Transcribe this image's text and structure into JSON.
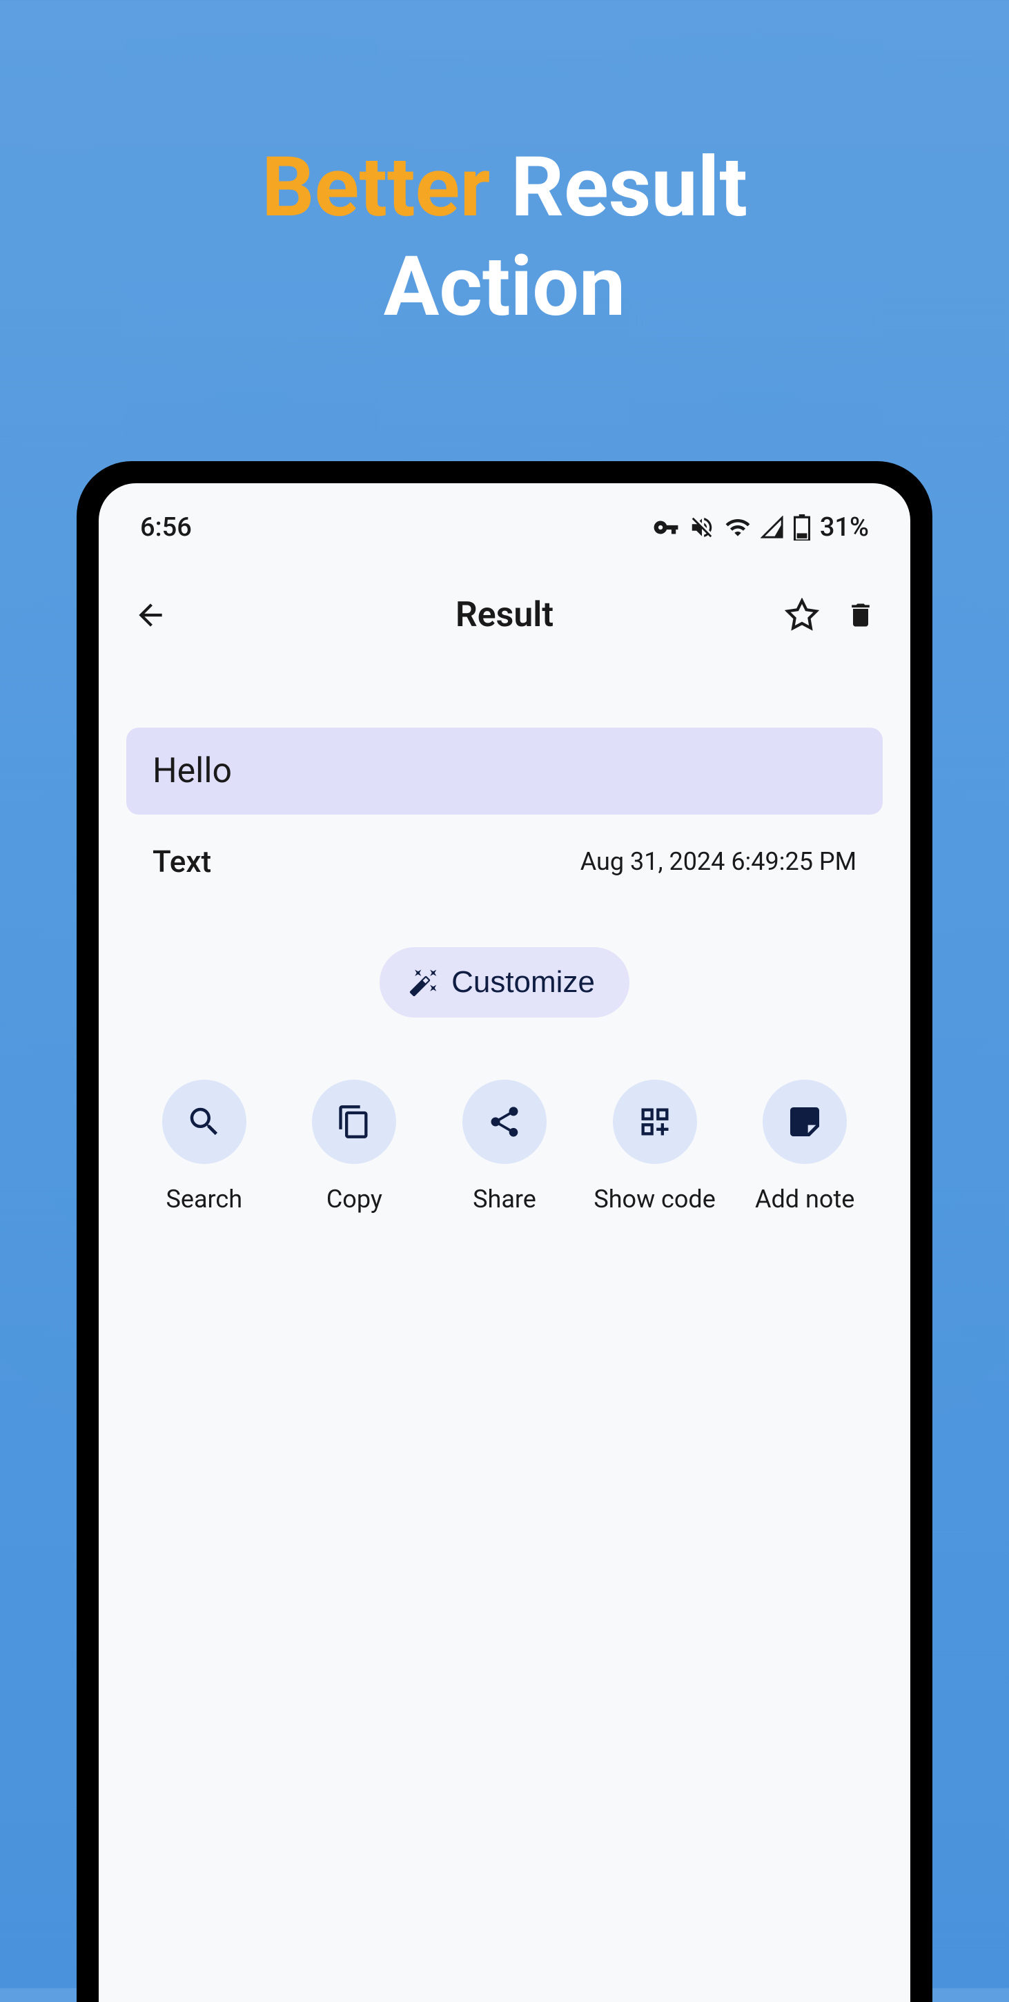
{
  "marketing": {
    "line1_accent": "Better",
    "line1_rest": " Result",
    "line2": "Action"
  },
  "status_bar": {
    "time": "6:56",
    "battery_text": "31%"
  },
  "app_bar": {
    "title": "Result"
  },
  "content": {
    "text": "Hello",
    "type_label": "Text",
    "timestamp": "Aug 31, 2024 6:49:25 PM"
  },
  "customize": {
    "label": "Customize"
  },
  "actions": {
    "search": "Search",
    "copy": "Copy",
    "share": "Share",
    "show_code": "Show code",
    "add_note": "Add note"
  }
}
